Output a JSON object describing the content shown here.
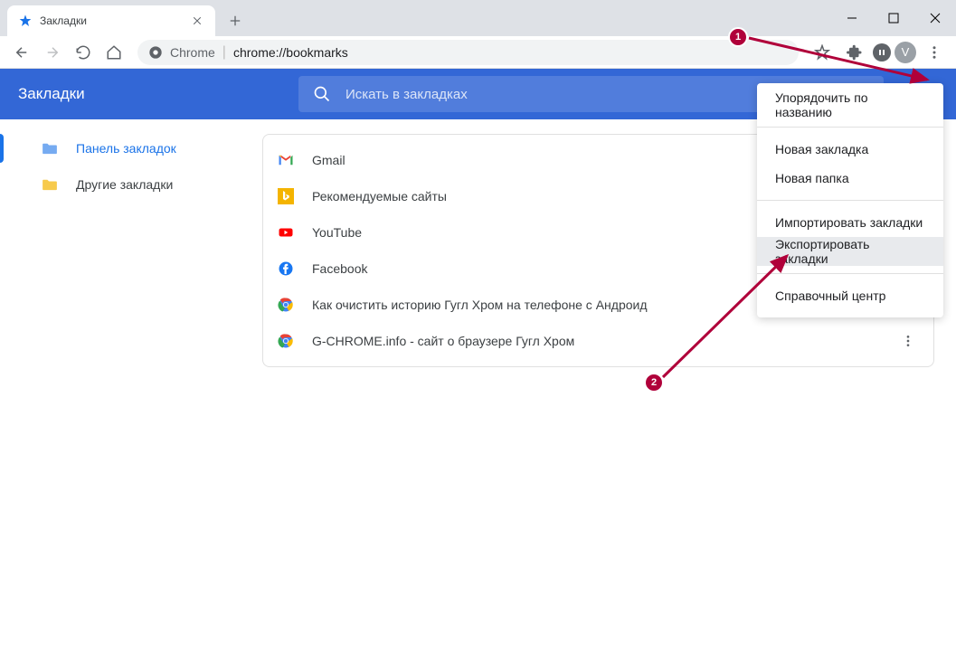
{
  "window": {
    "tab_title": "Закладки"
  },
  "toolbar": {
    "omnibox_label": "Chrome",
    "omnibox_url": "chrome://bookmarks",
    "avatar_letter": "V"
  },
  "app": {
    "title": "Закладки",
    "search_placeholder": "Искать в закладках"
  },
  "sidebar": {
    "items": [
      {
        "label": "Панель закладок",
        "active": true
      },
      {
        "label": "Другие закладки",
        "active": false
      }
    ]
  },
  "bookmarks": [
    {
      "label": "Gmail",
      "icon": "gmail"
    },
    {
      "label": "Рекомендуемые сайты",
      "icon": "bing"
    },
    {
      "label": "YouTube",
      "icon": "youtube"
    },
    {
      "label": "Facebook",
      "icon": "facebook"
    },
    {
      "label": "Как очистить историю Гугл Хром на телефоне с Андроид",
      "icon": "chrome"
    },
    {
      "label": "G-CHROME.info - сайт о браузере Гугл Хром",
      "icon": "chrome"
    }
  ],
  "dropdown": {
    "items": [
      {
        "label": "Упорядочить по названию",
        "sep_after": true
      },
      {
        "label": "Новая закладка"
      },
      {
        "label": "Новая папка",
        "sep_after": true
      },
      {
        "label": "Импортировать закладки"
      },
      {
        "label": "Экспортировать закладки",
        "highlighted": true,
        "sep_after": true
      },
      {
        "label": "Справочный центр"
      }
    ]
  },
  "annotations": {
    "badge1": "1",
    "badge2": "2"
  }
}
